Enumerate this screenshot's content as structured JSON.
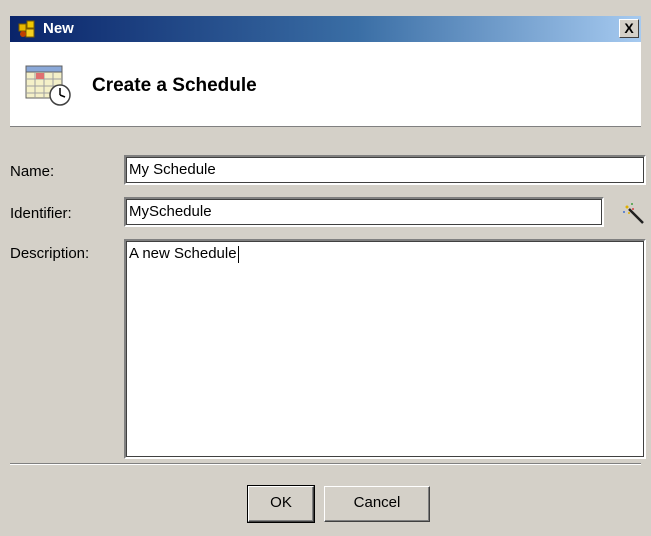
{
  "window": {
    "title": "New",
    "close_glyph": "X"
  },
  "header": {
    "title": "Create a Schedule",
    "icon": "calendar-clock-icon"
  },
  "form": {
    "name_label": "Name:",
    "name_value": "My Schedule",
    "identifier_label": "Identifier:",
    "identifier_value": "MySchedule",
    "description_label": "Description:",
    "description_value": "A new Schedule"
  },
  "buttons": {
    "ok_label": "OK",
    "cancel_label": "Cancel"
  },
  "colors": {
    "title_start": "#0a246a",
    "title_end": "#a6caf0",
    "face": "#d4d0c8"
  }
}
